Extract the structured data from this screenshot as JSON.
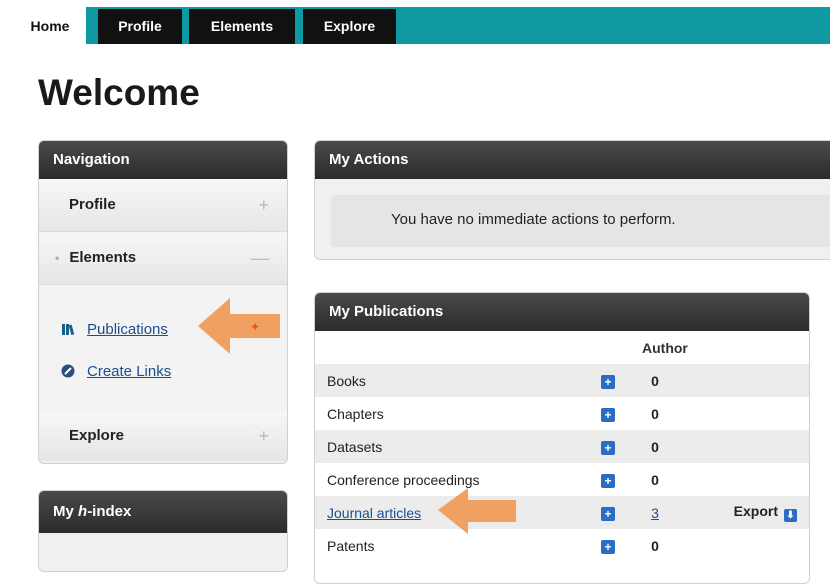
{
  "tabs": [
    {
      "label": "Home"
    },
    {
      "label": "Profile"
    },
    {
      "label": "Elements"
    },
    {
      "label": "Explore"
    }
  ],
  "page_title": "Welcome",
  "navigation": {
    "title": "Navigation",
    "profile": "Profile",
    "elements": "Elements",
    "sub": {
      "publications": "Publications",
      "create_links": "Create Links"
    },
    "explore": "Explore"
  },
  "hindex": {
    "title_prefix": "My ",
    "title_italic": "h",
    "title_suffix": "-index"
  },
  "actions": {
    "title": "My Actions",
    "message": "You have no immediate actions to perform."
  },
  "publications": {
    "title": "My Publications",
    "column_header": "Author",
    "rows": [
      {
        "label": "Books",
        "count": "0"
      },
      {
        "label": "Chapters",
        "count": "0"
      },
      {
        "label": "Datasets",
        "count": "0"
      },
      {
        "label": "Conference proceedings",
        "count": "0"
      },
      {
        "label": "Journal articles",
        "count": "3",
        "export": "Export"
      },
      {
        "label": "Patents",
        "count": "0"
      }
    ]
  },
  "colors": {
    "teal": "#0f9aa3",
    "arrow": "#f0a060",
    "link": "#1a4f8f"
  },
  "icons": [
    "books-icon",
    "link-icon",
    "plus-icon",
    "export-icon"
  ]
}
